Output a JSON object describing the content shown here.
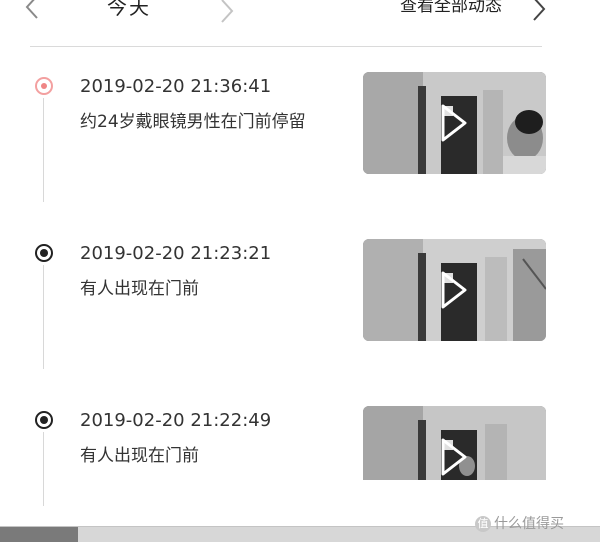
{
  "header": {
    "day_label": "今天",
    "view_all_label": "查看全部动态"
  },
  "icons": {
    "prev": "chevron-left-icon",
    "next": "chevron-right-icon",
    "more": "chevron-right-icon",
    "play": "play-icon"
  },
  "colors": {
    "alert_dot": "#ef8585",
    "normal_dot": "#222222",
    "timeline": "#d8d8d8"
  },
  "events": [
    {
      "timestamp": "2019-02-20  21:36:41",
      "description": "约24岁戴眼镜男性在门前停留",
      "status": "alert"
    },
    {
      "timestamp": "2019-02-20  21:23:21",
      "description": "有人出现在门前",
      "status": "normal"
    },
    {
      "timestamp": "2019-02-20  21:22:49",
      "description": "有人出现在门前",
      "status": "normal"
    }
  ],
  "watermark": {
    "badge": "值",
    "text": "什么值得买"
  }
}
